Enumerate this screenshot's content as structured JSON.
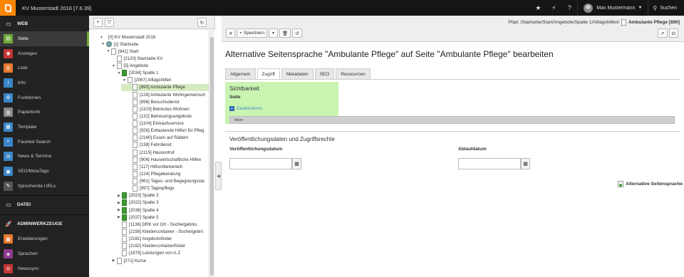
{
  "topbar": {
    "site_name": "KV Musterstadt 2016 [7.6.39]",
    "user_name": "Max Mustermann",
    "search_label": "Suchen"
  },
  "module_menu": {
    "groups": [
      {
        "label": "WEB",
        "items": [
          {
            "label": "Seite",
            "icon": "page-icon",
            "color": "#6daa3a",
            "active": true
          },
          {
            "label": "Anzeigen",
            "icon": "eye-icon",
            "color": "#c23535"
          },
          {
            "label": "Liste",
            "icon": "list-icon",
            "color": "#e8792e"
          },
          {
            "label": "Info",
            "icon": "info-icon",
            "color": "#3a86c8"
          },
          {
            "label": "Funktionen",
            "icon": "functions-icon",
            "color": "#3a86c8"
          },
          {
            "label": "Papierkorb",
            "icon": "trash-icon",
            "color": "#888888"
          },
          {
            "label": "Template",
            "icon": "template-icon",
            "color": "#3a86c8"
          },
          {
            "label": "Faceted Search",
            "icon": "faceted-search-icon",
            "color": "#3a86c8"
          },
          {
            "label": "News & Termine",
            "icon": "news-icon",
            "color": "#3a86c8"
          },
          {
            "label": "SEO/MetaTags",
            "icon": "seo-icon",
            "color": "#3a86c8"
          },
          {
            "label": "Sprechende URLs",
            "icon": "url-icon",
            "color": "#555555"
          }
        ]
      },
      {
        "label": "DATEI",
        "items": []
      },
      {
        "label": "ADMINWERKZEUGE",
        "items": [
          {
            "label": "Erweiterungen",
            "icon": "extensions-icon",
            "color": "#e8792e"
          },
          {
            "label": "Sprachen",
            "icon": "languages-icon",
            "color": "#8f3a8f"
          },
          {
            "label": "Newssync",
            "icon": "newssync-icon",
            "color": "#c23535"
          }
        ]
      }
    ]
  },
  "tree": {
    "nodes": [
      {
        "label": "[0] KV Musterstadt 2016",
        "depth": 0,
        "exp": "",
        "icon": "root"
      },
      {
        "label": "[1] Startseite",
        "depth": 1,
        "exp": "▼",
        "icon": "globe"
      },
      {
        "label": "[641] Start",
        "depth": 2,
        "exp": "▼",
        "icon": "page"
      },
      {
        "label": "[2120] Startseite KV",
        "depth": 3,
        "exp": "",
        "icon": "page"
      },
      {
        "label": "[5] Angebote",
        "depth": 3,
        "exp": "▼",
        "icon": "page"
      },
      {
        "label": "[2034] Spalte 1",
        "depth": 4,
        "exp": "▼",
        "icon": "green"
      },
      {
        "label": "[2067] Alltagshilfen",
        "depth": 5,
        "exp": "▼",
        "icon": "page"
      },
      {
        "label": "[890] Ambulante Pflege",
        "depth": 6,
        "exp": "",
        "icon": "page",
        "selected": true
      },
      {
        "label": "[128] Ambulante Wohngemeinsch",
        "depth": 6,
        "exp": "",
        "icon": "page"
      },
      {
        "label": "[896] Besuchsdienst",
        "depth": 6,
        "exp": "",
        "icon": "page"
      },
      {
        "label": "[1103] Betreutes Wohnen",
        "depth": 6,
        "exp": "",
        "icon": "page"
      },
      {
        "label": "[132] Betreuungsangebote",
        "depth": 6,
        "exp": "",
        "icon": "page"
      },
      {
        "label": "[1104] Einkaufsservice",
        "depth": 6,
        "exp": "",
        "icon": "page"
      },
      {
        "label": "[926] Entlastende Hilfen für Pfleg",
        "depth": 6,
        "exp": "",
        "icon": "page"
      },
      {
        "label": "[2160] Essen auf Rädern",
        "depth": 6,
        "exp": "",
        "icon": "page"
      },
      {
        "label": "[138] Fahrdienst",
        "depth": 6,
        "exp": "",
        "icon": "page"
      },
      {
        "label": "[2115] Hausnotruf",
        "depth": 6,
        "exp": "",
        "icon": "page"
      },
      {
        "label": "[906] Hauswirtschaftliche Hilfen",
        "depth": 6,
        "exp": "",
        "icon": "page"
      },
      {
        "label": "[117] Hilfsmittelverleih",
        "depth": 6,
        "exp": "",
        "icon": "page"
      },
      {
        "label": "[124] Pflegeberatung",
        "depth": 6,
        "exp": "",
        "icon": "page"
      },
      {
        "label": "[961] Tages- und Begegnungssta",
        "depth": 6,
        "exp": "",
        "icon": "page"
      },
      {
        "label": "[997] Tagespflege",
        "depth": 6,
        "exp": "",
        "icon": "page"
      },
      {
        "label": "[2023] Spalte 2",
        "depth": 4,
        "exp": "▶",
        "icon": "green"
      },
      {
        "label": "[2022] Spalte 3",
        "depth": 4,
        "exp": "▶",
        "icon": "green"
      },
      {
        "label": "[2036] Spalte 4",
        "depth": 4,
        "exp": "▶",
        "icon": "green"
      },
      {
        "label": "[2037] Spalte 5",
        "depth": 4,
        "exp": "▶",
        "icon": "green"
      },
      {
        "label": "[1136] DRK vor Ort - Suchergebnis",
        "depth": 4,
        "exp": "",
        "icon": "page"
      },
      {
        "label": "[2158] Kleidercontainer - Suchergebni",
        "depth": 4,
        "exp": "",
        "icon": "page"
      },
      {
        "label": "[2181] Angebotsfinder",
        "depth": 4,
        "exp": "",
        "icon": "page"
      },
      {
        "label": "[2182] Kleidercontainerfinder",
        "depth": 4,
        "exp": "",
        "icon": "page"
      },
      {
        "label": "[1879] Leistungen von A-Z",
        "depth": 4,
        "exp": "",
        "icon": "page"
      },
      {
        "label": "[271] Kurse",
        "depth": 3,
        "exp": "▶",
        "icon": "page"
      }
    ]
  },
  "docheader": {
    "path_prefix": "Pfad: /Startseite/Start/Angebote/Spalte 1/Alltagshilfen/",
    "path_page": "Ambulante Pflege [890]",
    "save_label": "Speichern"
  },
  "content": {
    "title": "Alternative Seitensprache \"Ambulante Pflege\" auf Seite \"Ambulante Pflege\" bearbeiten",
    "tabs": [
      "Allgemein",
      "Zugriff",
      "Metadaten",
      "SEO",
      "Ressourcen"
    ],
    "active_tab": 1,
    "visibility": {
      "title": "Sichtbarkeit",
      "field_label": "Seite",
      "checkbox_label": "Deaktivieren",
      "checked": true,
      "select_value": "Nein"
    },
    "publish": {
      "title": "Veröffentlichungsdaten und Zugriffsrechte",
      "start_label": "Veröffentlichungsdatum",
      "end_label": "Ablaufdatum",
      "start_value": "",
      "end_value": ""
    },
    "alt_link": "Alternative Seitensprache"
  }
}
